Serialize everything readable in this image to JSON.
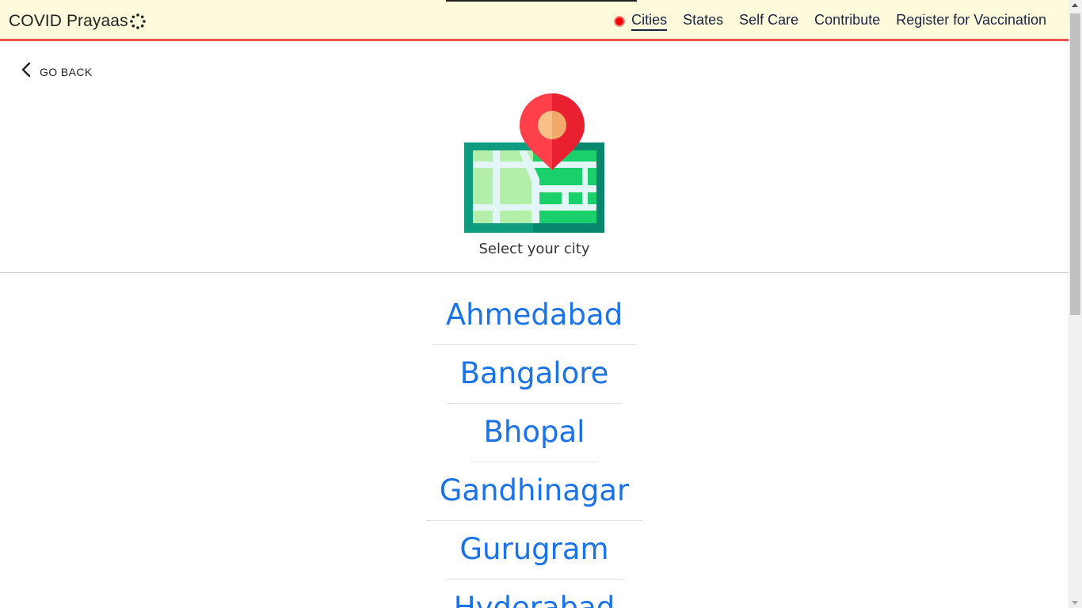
{
  "header": {
    "brand": "COVID Prayaas",
    "brand_icon": "spinner-dots-icon",
    "live_indicator_color": "#f40000",
    "nav": [
      {
        "label": "Cities",
        "active": true
      },
      {
        "label": "States",
        "active": false
      },
      {
        "label": "Self Care",
        "active": false
      },
      {
        "label": "Contribute",
        "active": false
      },
      {
        "label": "Register for Vaccination",
        "active": false
      }
    ],
    "background_color": "#fefadc",
    "border_color": "#ef5350"
  },
  "go_back": {
    "label": "GO BACK",
    "icon": "chevron-left-icon"
  },
  "hero": {
    "illustration": "map-pin-illustration",
    "caption": "Select your city"
  },
  "cities": [
    {
      "name": "Ahmedabad"
    },
    {
      "name": "Bangalore"
    },
    {
      "name": "Bhopal"
    },
    {
      "name": "Gandhinagar"
    },
    {
      "name": "Gurugram"
    },
    {
      "name": "Hyderabad"
    }
  ],
  "link_color": "#1a73e8"
}
